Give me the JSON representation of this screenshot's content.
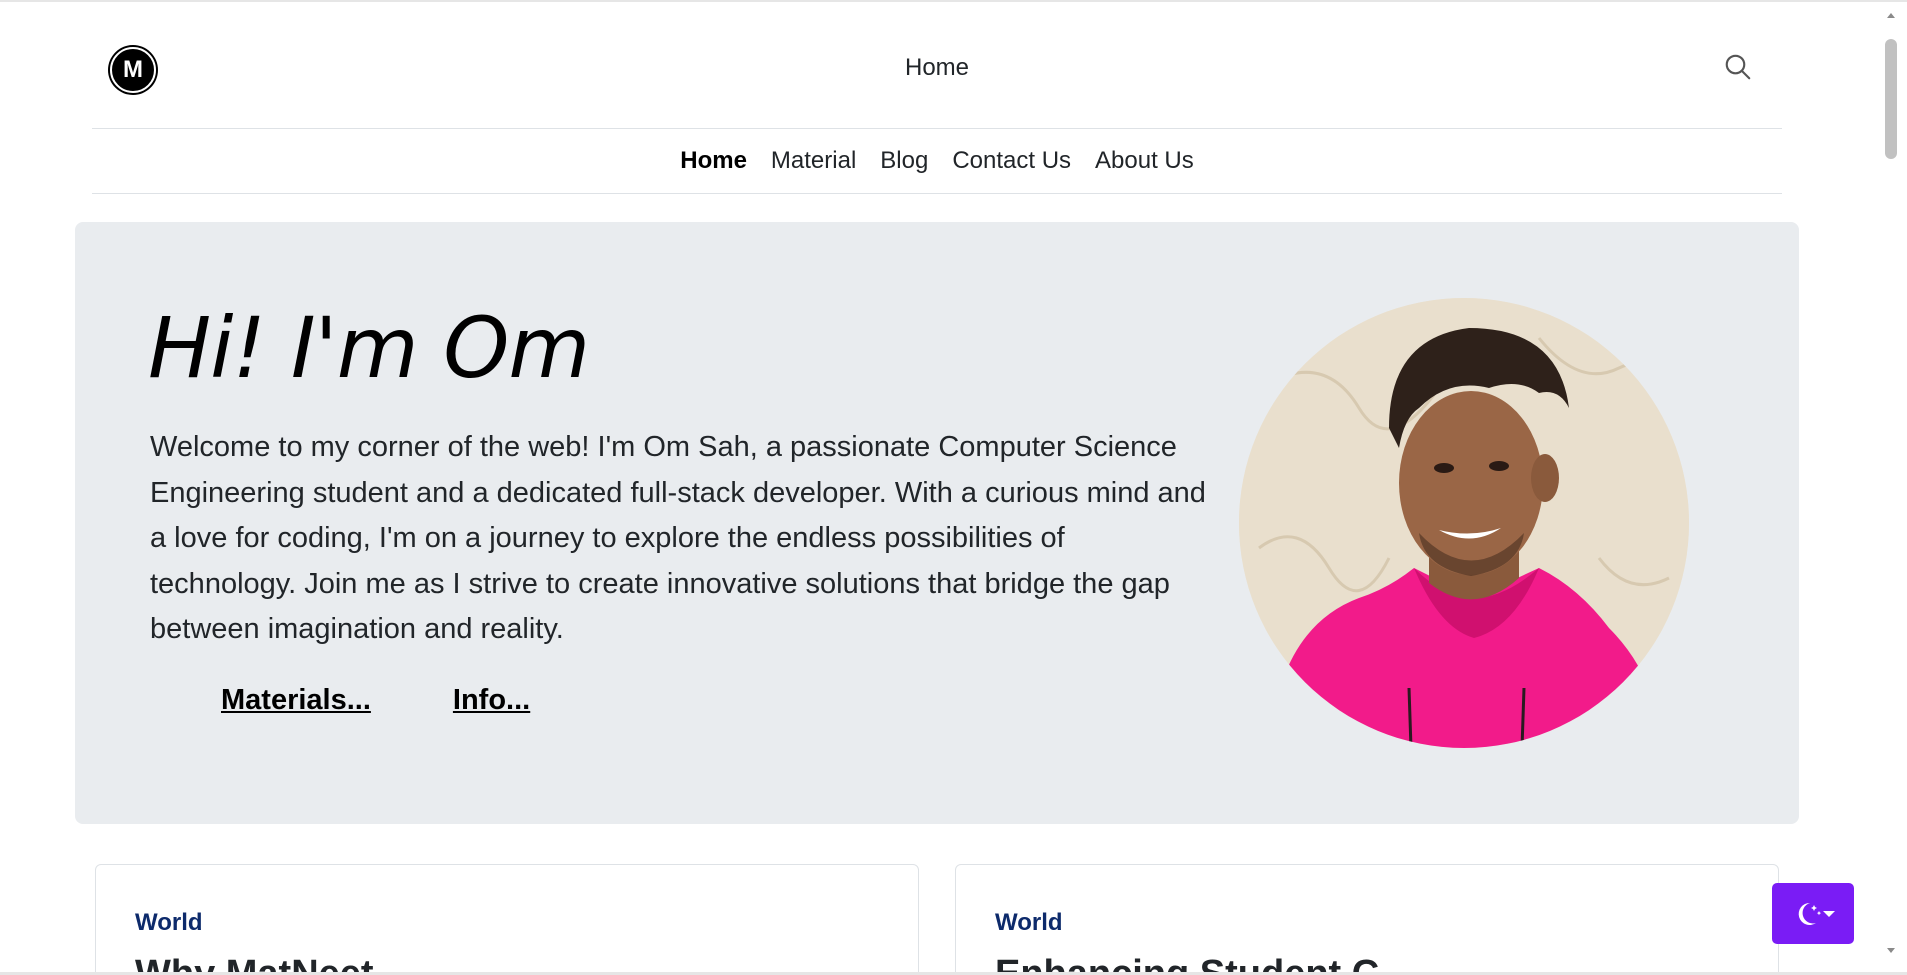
{
  "header": {
    "logo_letter": "M",
    "title": "Home"
  },
  "nav": {
    "items": [
      {
        "label": "Home",
        "active": true
      },
      {
        "label": "Material"
      },
      {
        "label": "Blog"
      },
      {
        "label": "Contact Us"
      },
      {
        "label": "About Us"
      }
    ]
  },
  "hero": {
    "title": "Hi! I'm Om",
    "text": "Welcome to my corner of the web! I'm Om Sah, a passionate Computer Science Engineering student and a dedicated full-stack developer. With a curious mind and a love for coding, I'm on a journey to explore the endless possibilities of technology. Join me as I strive to create innovative solutions that bridge the gap between imagination and reality.",
    "links": {
      "materials": "Materials...",
      "info": "Info..."
    }
  },
  "cards": [
    {
      "category": "World",
      "title": "Why MatNeet..."
    },
    {
      "category": "World",
      "title": "Enhancing Student C..."
    }
  ],
  "icons": {
    "search": "search-icon",
    "theme": "moon-stars-icon",
    "caret": "caret-down-icon"
  },
  "colors": {
    "hero_bg": "#e9ecef",
    "theme_button": "#7a1cf5",
    "card_category": "#0d2a6b"
  }
}
